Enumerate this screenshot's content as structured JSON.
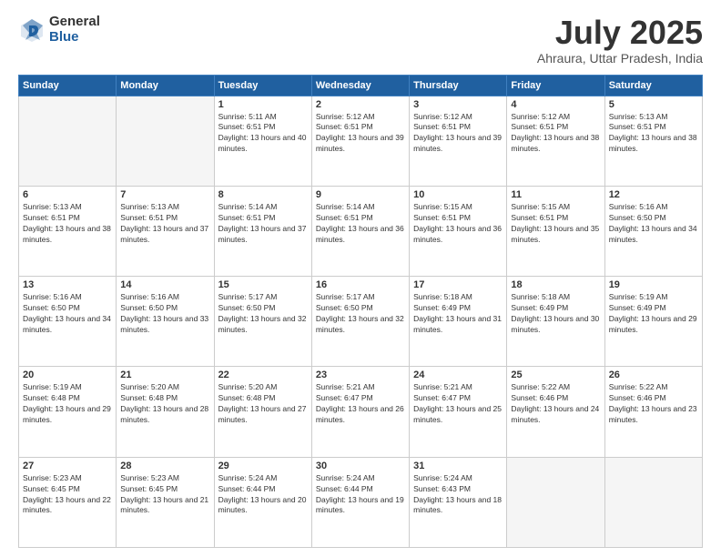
{
  "header": {
    "logo_general": "General",
    "logo_blue": "Blue",
    "title": "July 2025",
    "location": "Ahraura, Uttar Pradesh, India"
  },
  "weekdays": [
    "Sunday",
    "Monday",
    "Tuesday",
    "Wednesday",
    "Thursday",
    "Friday",
    "Saturday"
  ],
  "weeks": [
    [
      {
        "day": null
      },
      {
        "day": null
      },
      {
        "day": "1",
        "sunrise": "5:11 AM",
        "sunset": "6:51 PM",
        "daylight": "13 hours and 40 minutes."
      },
      {
        "day": "2",
        "sunrise": "5:12 AM",
        "sunset": "6:51 PM",
        "daylight": "13 hours and 39 minutes."
      },
      {
        "day": "3",
        "sunrise": "5:12 AM",
        "sunset": "6:51 PM",
        "daylight": "13 hours and 39 minutes."
      },
      {
        "day": "4",
        "sunrise": "5:12 AM",
        "sunset": "6:51 PM",
        "daylight": "13 hours and 38 minutes."
      },
      {
        "day": "5",
        "sunrise": "5:13 AM",
        "sunset": "6:51 PM",
        "daylight": "13 hours and 38 minutes."
      }
    ],
    [
      {
        "day": "6",
        "sunrise": "5:13 AM",
        "sunset": "6:51 PM",
        "daylight": "13 hours and 38 minutes."
      },
      {
        "day": "7",
        "sunrise": "5:13 AM",
        "sunset": "6:51 PM",
        "daylight": "13 hours and 37 minutes."
      },
      {
        "day": "8",
        "sunrise": "5:14 AM",
        "sunset": "6:51 PM",
        "daylight": "13 hours and 37 minutes."
      },
      {
        "day": "9",
        "sunrise": "5:14 AM",
        "sunset": "6:51 PM",
        "daylight": "13 hours and 36 minutes."
      },
      {
        "day": "10",
        "sunrise": "5:15 AM",
        "sunset": "6:51 PM",
        "daylight": "13 hours and 36 minutes."
      },
      {
        "day": "11",
        "sunrise": "5:15 AM",
        "sunset": "6:51 PM",
        "daylight": "13 hours and 35 minutes."
      },
      {
        "day": "12",
        "sunrise": "5:16 AM",
        "sunset": "6:50 PM",
        "daylight": "13 hours and 34 minutes."
      }
    ],
    [
      {
        "day": "13",
        "sunrise": "5:16 AM",
        "sunset": "6:50 PM",
        "daylight": "13 hours and 34 minutes."
      },
      {
        "day": "14",
        "sunrise": "5:16 AM",
        "sunset": "6:50 PM",
        "daylight": "13 hours and 33 minutes."
      },
      {
        "day": "15",
        "sunrise": "5:17 AM",
        "sunset": "6:50 PM",
        "daylight": "13 hours and 32 minutes."
      },
      {
        "day": "16",
        "sunrise": "5:17 AM",
        "sunset": "6:50 PM",
        "daylight": "13 hours and 32 minutes."
      },
      {
        "day": "17",
        "sunrise": "5:18 AM",
        "sunset": "6:49 PM",
        "daylight": "13 hours and 31 minutes."
      },
      {
        "day": "18",
        "sunrise": "5:18 AM",
        "sunset": "6:49 PM",
        "daylight": "13 hours and 30 minutes."
      },
      {
        "day": "19",
        "sunrise": "5:19 AM",
        "sunset": "6:49 PM",
        "daylight": "13 hours and 29 minutes."
      }
    ],
    [
      {
        "day": "20",
        "sunrise": "5:19 AM",
        "sunset": "6:48 PM",
        "daylight": "13 hours and 29 minutes."
      },
      {
        "day": "21",
        "sunrise": "5:20 AM",
        "sunset": "6:48 PM",
        "daylight": "13 hours and 28 minutes."
      },
      {
        "day": "22",
        "sunrise": "5:20 AM",
        "sunset": "6:48 PM",
        "daylight": "13 hours and 27 minutes."
      },
      {
        "day": "23",
        "sunrise": "5:21 AM",
        "sunset": "6:47 PM",
        "daylight": "13 hours and 26 minutes."
      },
      {
        "day": "24",
        "sunrise": "5:21 AM",
        "sunset": "6:47 PM",
        "daylight": "13 hours and 25 minutes."
      },
      {
        "day": "25",
        "sunrise": "5:22 AM",
        "sunset": "6:46 PM",
        "daylight": "13 hours and 24 minutes."
      },
      {
        "day": "26",
        "sunrise": "5:22 AM",
        "sunset": "6:46 PM",
        "daylight": "13 hours and 23 minutes."
      }
    ],
    [
      {
        "day": "27",
        "sunrise": "5:23 AM",
        "sunset": "6:45 PM",
        "daylight": "13 hours and 22 minutes."
      },
      {
        "day": "28",
        "sunrise": "5:23 AM",
        "sunset": "6:45 PM",
        "daylight": "13 hours and 21 minutes."
      },
      {
        "day": "29",
        "sunrise": "5:24 AM",
        "sunset": "6:44 PM",
        "daylight": "13 hours and 20 minutes."
      },
      {
        "day": "30",
        "sunrise": "5:24 AM",
        "sunset": "6:44 PM",
        "daylight": "13 hours and 19 minutes."
      },
      {
        "day": "31",
        "sunrise": "5:24 AM",
        "sunset": "6:43 PM",
        "daylight": "13 hours and 18 minutes."
      },
      {
        "day": null
      },
      {
        "day": null
      }
    ]
  ],
  "labels": {
    "sunrise": "Sunrise:",
    "sunset": "Sunset:",
    "daylight": "Daylight:"
  }
}
